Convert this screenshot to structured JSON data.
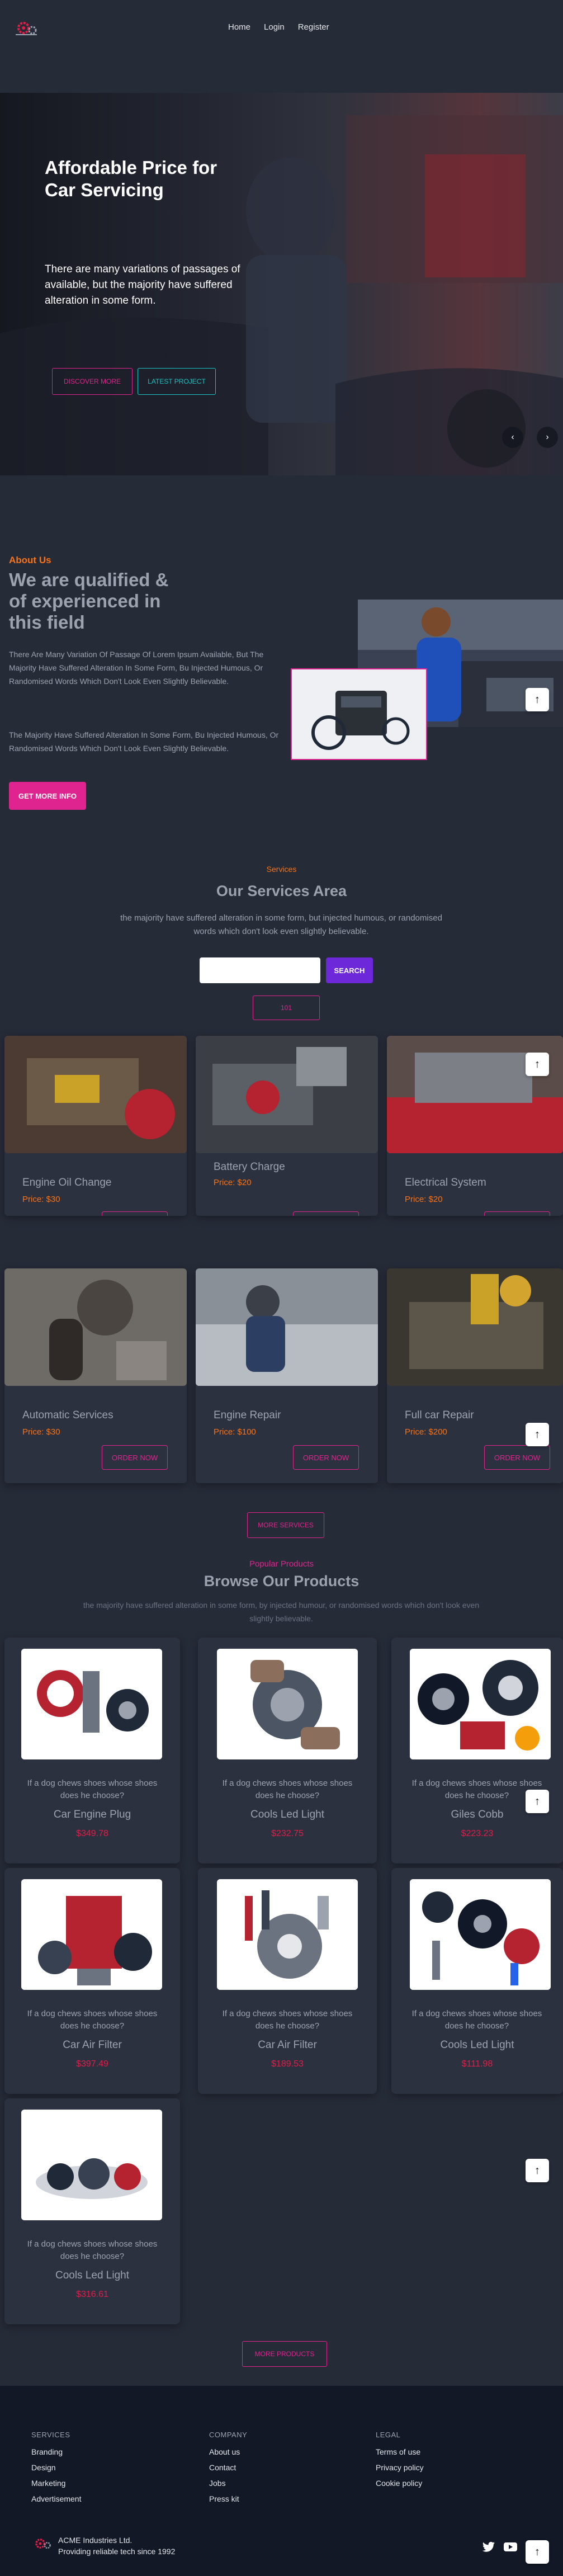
{
  "nav": {
    "links": [
      "Home",
      "Login",
      "Register"
    ]
  },
  "hero": {
    "title": "Affordable Price for Car Servicing",
    "text": "There are many variations of passages of available, but the majority have suffered alteration in some form.",
    "discover_label": "DISCOVER MORE",
    "latest_label": "LATEST PROJECT",
    "prev_icon": "chevron-left-icon",
    "next_icon": "chevron-right-icon"
  },
  "about": {
    "label": "About Us",
    "title": "We are qualified & of experienced in this field",
    "p1": "There Are Many Variation Of Passage Of Lorem Ipsum Available, But The Majority Have Suffered Alteration In Some Form, Bu Injected Humous, Or Randomised Words Which Don't Look Even Slightly Believable.",
    "p2": "The Majority Have Suffered Alteration In Some Form, Bu Injected Humous, Or Randomised Words Which Don't Look Even Slightly Believable.",
    "button": "GET MORE INFO"
  },
  "services": {
    "label": "Services",
    "title": "Our Services Area",
    "subtitle": "the majority have suffered alteration in some form, but injected humous, or randomised words which don't look even slightly believable.",
    "search_placeholder": "",
    "search_button": "SEARCH",
    "count_label": "101",
    "price_prefix": "Price:",
    "order_label": "ORDER NOW",
    "more_label": "MORE SERVICES",
    "items": [
      {
        "name": "Engine Oil Change",
        "price": "$30"
      },
      {
        "name": "Battery Charge",
        "price": "$20"
      },
      {
        "name": "Electrical System",
        "price": "$20"
      },
      {
        "name": "Automatic Services",
        "price": "$30"
      },
      {
        "name": "Engine Repair",
        "price": "$100"
      },
      {
        "name": "Full car Repair",
        "price": "$200"
      }
    ]
  },
  "products": {
    "label": "Popular Products",
    "title": "Browse Our Products",
    "subtitle": "the majority have suffered alteration in some form, by injected humour, or randomised words which don't look even slightly believable.",
    "more_label": "MORE PRODUCTS",
    "items": [
      {
        "desc": "If a dog chews shoes whose shoes does he choose?",
        "name": "Car Engine Plug",
        "price": "$349.78"
      },
      {
        "desc": "If a dog chews shoes whose shoes does he choose?",
        "name": "Cools Led Light",
        "price": "$232.75"
      },
      {
        "desc": "If a dog chews shoes whose shoes does he choose?",
        "name": "Giles Cobb",
        "price": "$223.23"
      },
      {
        "desc": "If a dog chews shoes whose shoes does he choose?",
        "name": "Car Air Filter",
        "price": "$397.49"
      },
      {
        "desc": "If a dog chews shoes whose shoes does he choose?",
        "name": "Car Air Filter",
        "price": "$189.53"
      },
      {
        "desc": "If a dog chews shoes whose shoes does he choose?",
        "name": "Cools Led Light",
        "price": "$111.98"
      },
      {
        "desc": "If a dog chews shoes whose shoes does he choose?",
        "name": "Cools Led Light",
        "price": "$316.61"
      }
    ]
  },
  "footer": {
    "services_head": "SERVICES",
    "services_links": [
      "Branding",
      "Design",
      "Marketing",
      "Advertisement"
    ],
    "company_head": "COMPANY",
    "company_links": [
      "About us",
      "Contact",
      "Jobs",
      "Press kit"
    ],
    "legal_head": "LEGAL",
    "legal_links": [
      "Terms of use",
      "Privacy policy",
      "Cookie policy"
    ],
    "company_name": "ACME Industries Ltd.",
    "tagline": "Providing reliable tech since 1992"
  },
  "colors": {
    "accent_pink": "#e0248f",
    "accent_orange": "#f97316",
    "accent_teal": "#1bc4c4",
    "accent_purple": "#6d28d9",
    "price_red": "#e11d48"
  }
}
